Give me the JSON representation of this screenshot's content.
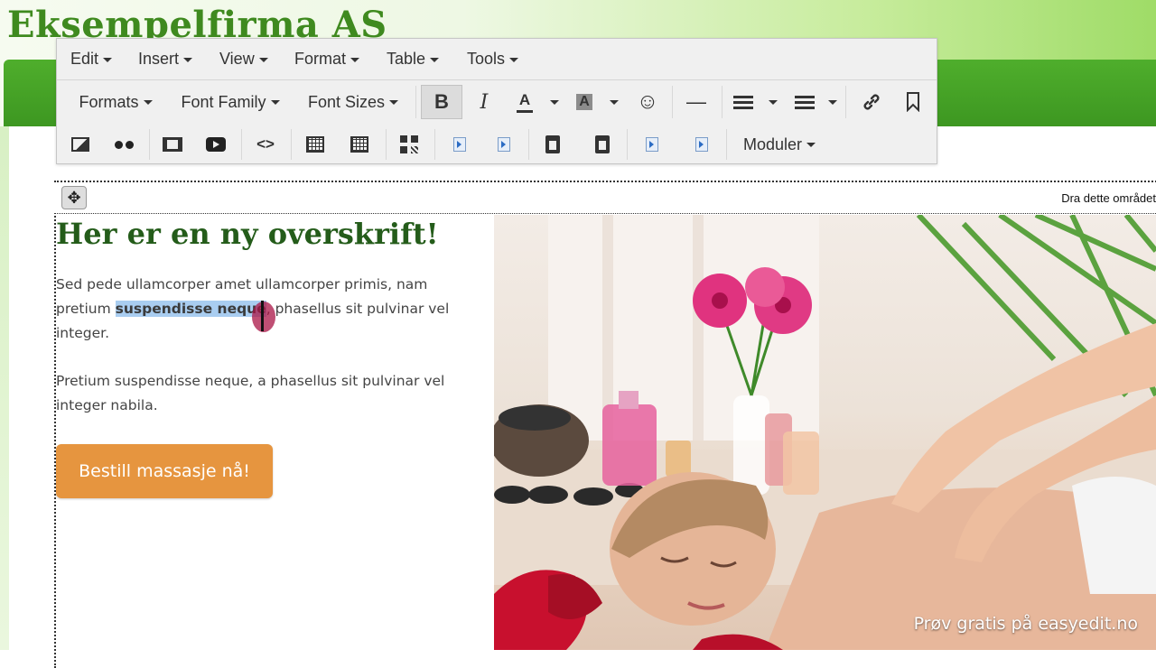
{
  "site": {
    "title": "Eksempelfirma AS"
  },
  "menubar": {
    "items": [
      "Edit",
      "Insert",
      "View",
      "Format",
      "Table",
      "Tools"
    ]
  },
  "toolbar": {
    "formats_label": "Formats",
    "font_family_label": "Font Family",
    "font_sizes_label": "Font Sizes",
    "bold_glyph": "B",
    "italic_glyph": "I",
    "font_color_glyph": "A",
    "bg_color_glyph": "A",
    "emoji_glyph": "☺",
    "hr_glyph": "—",
    "code_glyph": "<>",
    "moduler_label": "Moduler",
    "icons": {
      "link": "link-icon",
      "bookmark": "bookmark-icon",
      "image": "image-icon",
      "flickr": "flickr-icon",
      "video": "video-icon",
      "youtube": "youtube-icon",
      "source_code": "source-code-icon",
      "table_a": "table-icon",
      "table_b": "table-icon",
      "qr": "qr-code-icon",
      "template_a": "template-icon",
      "template_b": "template-icon",
      "paste": "paste-icon",
      "paste_text": "paste-text-icon",
      "template_c": "template-icon",
      "template_d": "template-icon"
    }
  },
  "editor": {
    "move_glyph": "✥",
    "drag_label": "Dra dette området",
    "heading": "Her er en ny overskrift!",
    "paragraph1": {
      "before": "Sed pede ullamcorper amet ullamcorper primis, nam pretium ",
      "selected": "suspendisse neque",
      "after": ", phasellus sit pulvinar vel integer."
    },
    "paragraph2": "Pretium suspendisse neque, a phasellus sit pulvinar vel integer nabila.",
    "cta_label": "Bestill massasje nå!"
  },
  "overlay": {
    "watermark": "Prøv gratis på easyedit.no"
  },
  "colors": {
    "brand_green": "#3f8a1f",
    "nav_green": "#4fae2c",
    "heading_green": "#245c1a",
    "cta_orange": "#e6953f",
    "selection_blue": "#a9cdf0"
  }
}
